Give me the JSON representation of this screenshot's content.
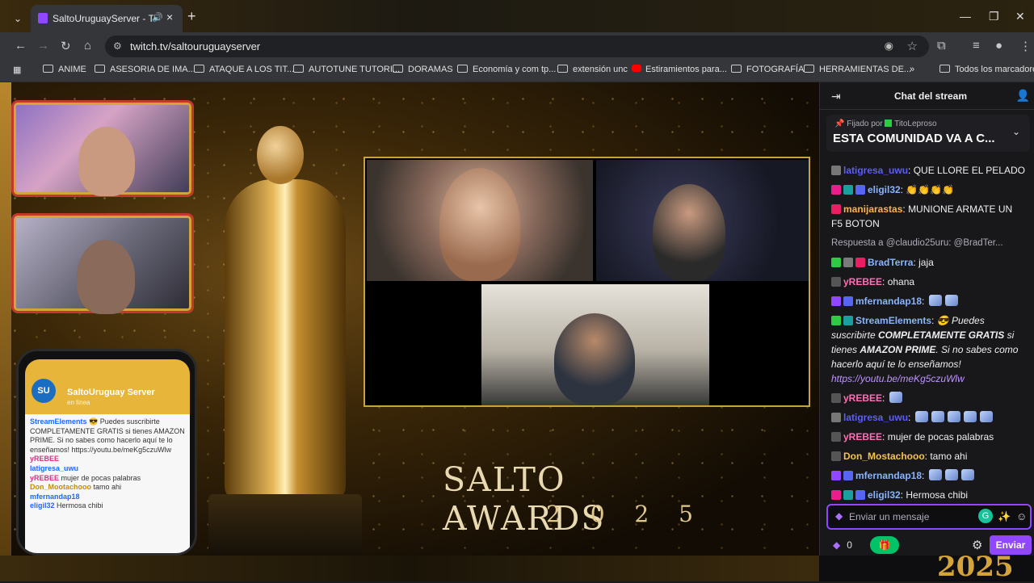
{
  "browser": {
    "tab_title": "SaltoUruguayServer - Twitch",
    "url": "twitch.tv/saltouruguayserver",
    "bookmarks": [
      {
        "label": "ANIME",
        "type": "folder"
      },
      {
        "label": "ASESORIA DE IMA...",
        "type": "folder"
      },
      {
        "label": "ATAQUE A LOS TIT...",
        "type": "folder"
      },
      {
        "label": "AUTOTUNE TUTORI...",
        "type": "folder"
      },
      {
        "label": "DORAMAS",
        "type": "folder"
      },
      {
        "label": "Economía y com tp...",
        "type": "folder"
      },
      {
        "label": "extensión unc",
        "type": "folder"
      },
      {
        "label": "Estiramientos para...",
        "type": "youtube"
      },
      {
        "label": "FOTOGRAFÍA",
        "type": "folder"
      },
      {
        "label": "HERRAMIENTAS DE...",
        "type": "folder"
      },
      {
        "label": "Todos los marcadores",
        "type": "folder"
      }
    ],
    "more_bookmarks": "»"
  },
  "stream": {
    "title_line": "SALTO AWARDS",
    "year_line": "2 0 2 5",
    "bottom_year": "2025",
    "phone": {
      "channel": "SaltoUruguay Server",
      "status": "en línea",
      "logo": "SU",
      "messages": [
        {
          "user": "StreamElements",
          "text": "😎 Puedes suscribirte COMPLETAMENTE GRATIS si tienes AMAZON PRIME. Si no sabes como hacerlo aquí te lo enseñamos! https://youtu.be/meKg5czuWlw",
          "color": "#1e69ff"
        },
        {
          "user": "yREBEE",
          "text": "",
          "color": "#d63384"
        },
        {
          "user": "latigresa_uwu",
          "text": "",
          "color": "#1e69ff"
        },
        {
          "user": "yREBEE",
          "text": "mujer de pocas palabras",
          "color": "#d63384"
        },
        {
          "user": "Don_Mootachooo",
          "text": "tamo ahi",
          "color": "#c09000"
        },
        {
          "user": "mfernandap18",
          "text": "",
          "color": "#1e69ff"
        },
        {
          "user": "eligil32",
          "text": "Hermosa chibi",
          "color": "#1e69ff"
        }
      ]
    }
  },
  "chat": {
    "title": "Chat del stream",
    "pinned_by_prefix": "Fijado por",
    "pinned_by_user": "TitoLeproso",
    "pinned_message": "ESTA COMUNIDAD VA A C...",
    "messages": [
      {
        "user": "latigresa_uwu",
        "color": "#5c5cff",
        "text": "QUE LLORE EL PELADO",
        "badges": [
          "#777777"
        ],
        "emotes": 0
      },
      {
        "user": "eligil32",
        "color": "#8ab4ff",
        "text": "👏👏👏👏",
        "badges": [
          "#e91e8c",
          "#1b9e9e",
          "#5865f2"
        ],
        "emotes": 0
      },
      {
        "user": "manijarastas",
        "color": "#ffb347",
        "text": "MUNIONE ARMATE UN F5 BOTON",
        "badges": [
          "#e91e63"
        ],
        "emotes": 0
      },
      {
        "reply": true,
        "text": "Respuesta a @claudio25uru: @BradTer..."
      },
      {
        "user": "BradTerra",
        "color": "#8ab4ff",
        "text": "jaja",
        "badges": [
          "#2ecc40",
          "#7a7a7a",
          "#e91e63"
        ],
        "emotes": 0
      },
      {
        "user": "yREBEE",
        "color": "#ff6fb5",
        "text": "ohana",
        "badges": [
          "#555555"
        ],
        "emotes": 0
      },
      {
        "user": "mfernandap18",
        "color": "#8ab4ff",
        "text": "",
        "badges": [
          "#9146ff",
          "#5865f2"
        ],
        "emotes": 2
      },
      {
        "user": "StreamElements",
        "color": "#8ab4ff",
        "badges": [
          "#2ecc40",
          "#1b9e9e"
        ],
        "emotes": 0,
        "se": true,
        "text_a": "😎 Puedes suscribirte ",
        "text_b": "COMPLETAMENTE GRATIS",
        "text_c": " si tienes ",
        "text_d": "AMAZON PRIME",
        "text_e": ". Si no sabes como hacerlo aquí te lo enseñamos! ",
        "link": "https://youtu.be/meKg5czuWlw"
      },
      {
        "user": "yREBEE",
        "color": "#ff6fb5",
        "text": "",
        "badges": [
          "#555555"
        ],
        "emotes": 1
      },
      {
        "user": "latigresa_uwu",
        "color": "#5c5cff",
        "text": "",
        "badges": [
          "#777777"
        ],
        "emotes": 5
      },
      {
        "user": "yREBEE",
        "color": "#ff6fb5",
        "text": "mujer de pocas palabras",
        "badges": [
          "#555555"
        ],
        "emotes": 0
      },
      {
        "user": "Don_Mostachooo",
        "color": "#f5c542",
        "text": "tamo ahi",
        "badges": [
          "#555555"
        ],
        "emotes": 0
      },
      {
        "user": "mfernandap18",
        "color": "#8ab4ff",
        "text": "",
        "badges": [
          "#9146ff",
          "#5865f2"
        ],
        "emotes": 3
      },
      {
        "user": "eligil32",
        "color": "#8ab4ff",
        "text": "Hermosa chibi",
        "badges": [
          "#e91e8c",
          "#1b9e9e",
          "#5865f2"
        ],
        "emotes": 0
      }
    ],
    "input_placeholder": "Enviar un mensaje",
    "points": "0",
    "send_label": "Enviar"
  },
  "colors": {
    "twitch_purple": "#9146ff",
    "gold": "#d4a43a"
  }
}
